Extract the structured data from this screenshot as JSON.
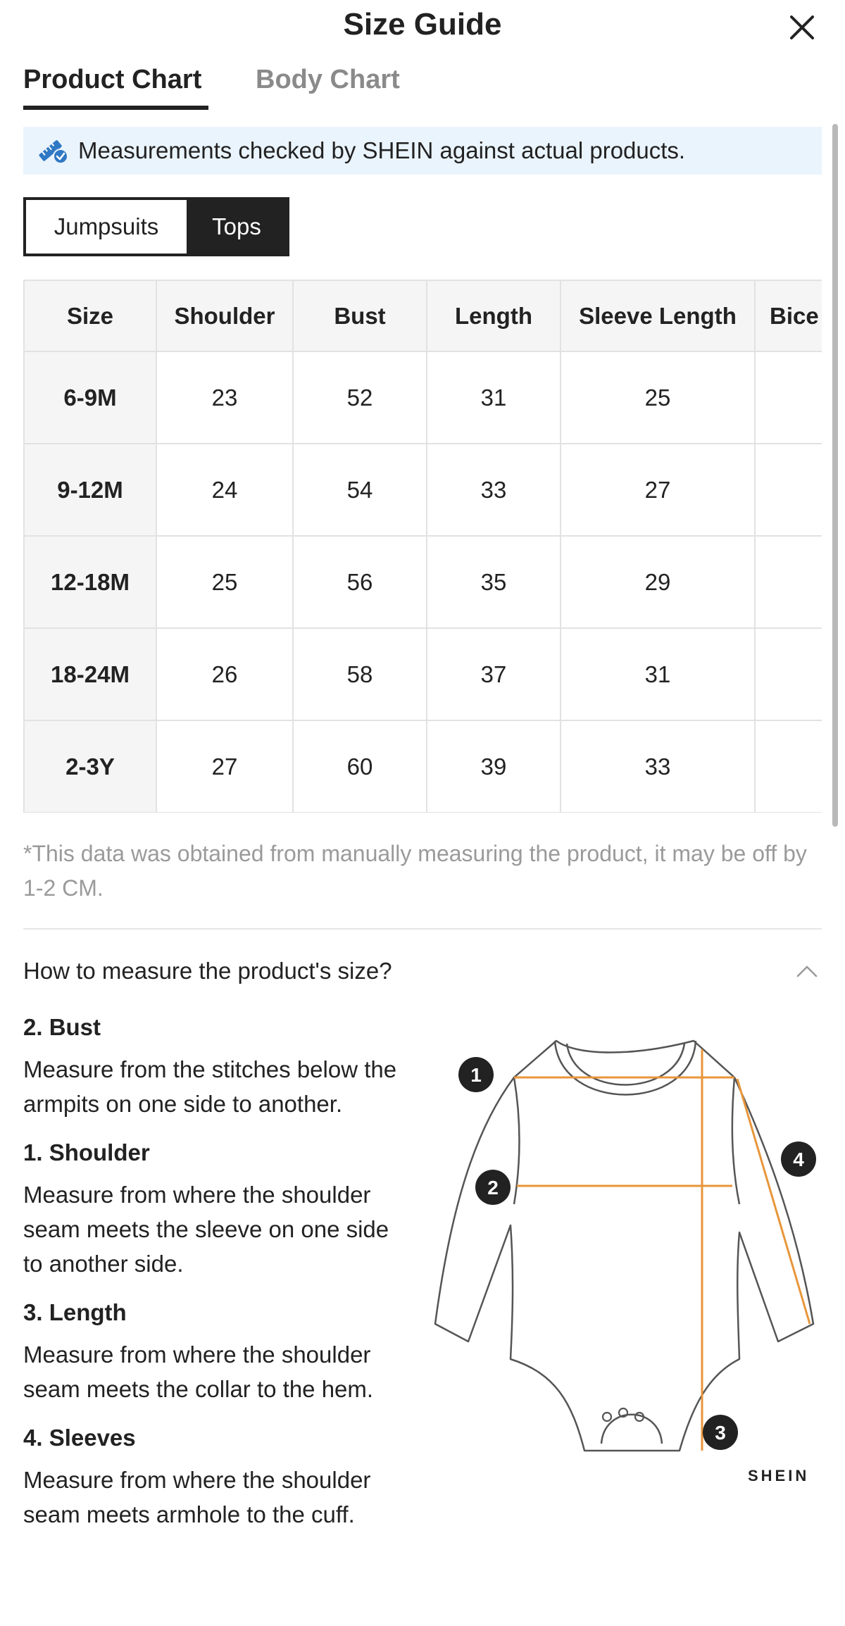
{
  "header": {
    "title": "Size Guide"
  },
  "tabs": [
    {
      "label": "Product Chart",
      "active": true
    },
    {
      "label": "Body Chart",
      "active": false
    }
  ],
  "notice": {
    "text": "Measurements checked by SHEIN against actual products.",
    "icon": "ruler-check-icon"
  },
  "segments": [
    {
      "label": "Jumpsuits",
      "selected": false
    },
    {
      "label": "Tops",
      "selected": true
    }
  ],
  "table": {
    "headers": [
      "Size",
      "Shoulder",
      "Bust",
      "Length",
      "Sleeve Length",
      "Bice"
    ],
    "rows": [
      {
        "size": "6-9M",
        "shoulder": "23",
        "bust": "52",
        "length": "31",
        "sleeve": "25"
      },
      {
        "size": "9-12M",
        "shoulder": "24",
        "bust": "54",
        "length": "33",
        "sleeve": "27"
      },
      {
        "size": "12-18M",
        "shoulder": "25",
        "bust": "56",
        "length": "35",
        "sleeve": "29"
      },
      {
        "size": "18-24M",
        "shoulder": "26",
        "bust": "58",
        "length": "37",
        "sleeve": "31"
      },
      {
        "size": "2-3Y",
        "shoulder": "27",
        "bust": "60",
        "length": "39",
        "sleeve": "33"
      }
    ]
  },
  "disclaimer": "*This data was obtained from manually measuring the product, it may be off by 1-2 CM.",
  "measure": {
    "title": "How to measure the product's size?",
    "expanded": true,
    "items": [
      {
        "heading": "2. Bust",
        "text": "Measure from the stitches below the armpits on one side to another."
      },
      {
        "heading": "1. Shoulder",
        "text": "Measure from where the shoulder seam meets the sleeve on one side to another side."
      },
      {
        "heading": "3. Length",
        "text": "Measure from where the shoulder seam meets the collar to the hem."
      },
      {
        "heading": "4. Sleeves",
        "text": "Measure from where the shoulder seam meets armhole to the cuff."
      }
    ]
  },
  "diagram": {
    "markers": [
      "1",
      "2",
      "3",
      "4"
    ],
    "brand": "SHEIN",
    "line_color": "#e8963a"
  },
  "colors": {
    "accent": "#222222",
    "notice_bg": "#eaf4fd",
    "muted": "#8a8a8a"
  }
}
